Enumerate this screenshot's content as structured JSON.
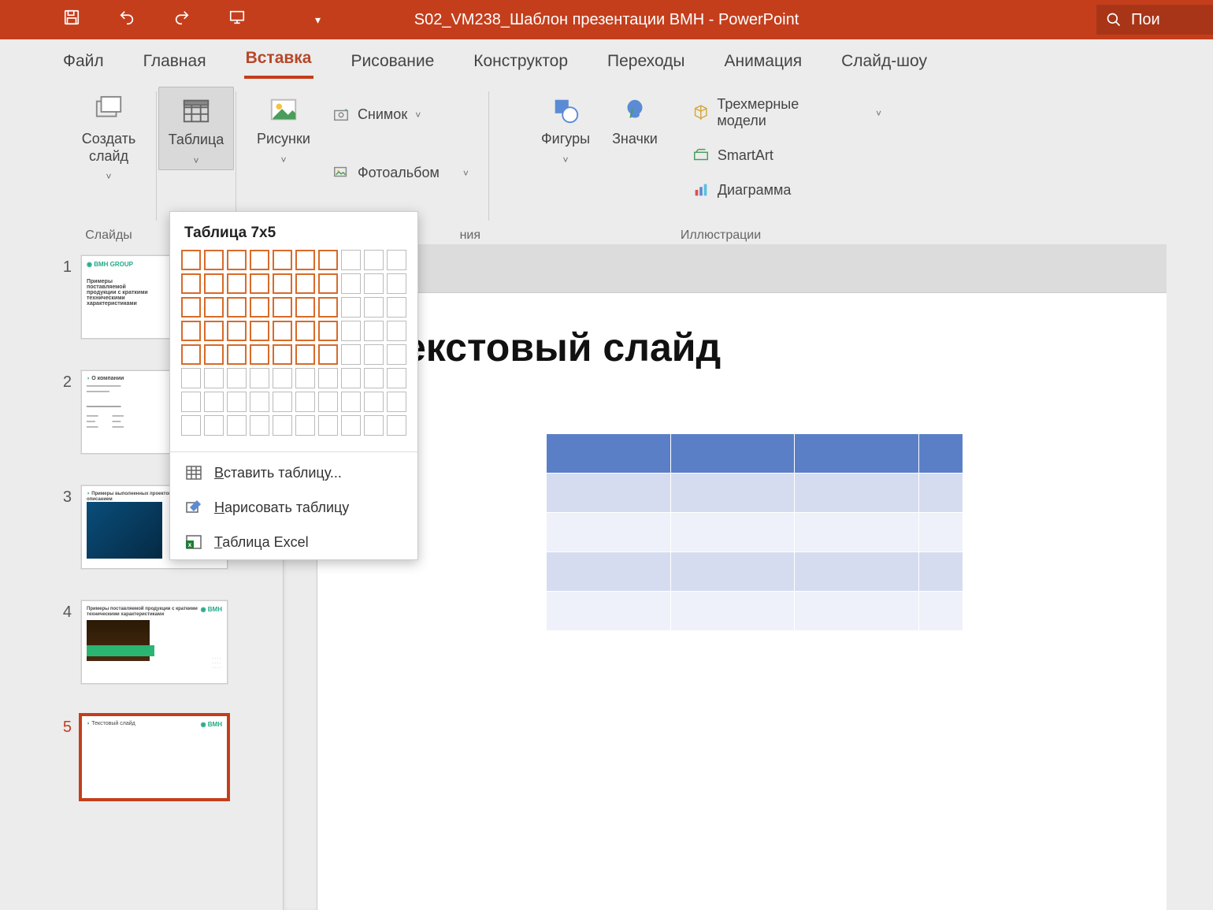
{
  "titlebar": {
    "document": "S02_VM238_Шаблон презентации BMH",
    "separator": " - ",
    "app": "PowerPoint",
    "search_label": "Пои"
  },
  "tabs": {
    "items": [
      {
        "label": "Файл"
      },
      {
        "label": "Главная"
      },
      {
        "label": "Вставка",
        "active": true
      },
      {
        "label": "Рисование"
      },
      {
        "label": "Конструктор"
      },
      {
        "label": "Переходы"
      },
      {
        "label": "Анимация"
      },
      {
        "label": "Слайд-шоу"
      }
    ]
  },
  "ribbon": {
    "new_slide": "Создать\nслайд",
    "table": "Таблица",
    "pictures": "Рисунки",
    "screenshot": "Снимок",
    "photo_album": "Фотоальбом",
    "shapes": "Фигуры",
    "icons": "Значки",
    "models3d": "Трехмерные модели",
    "smartart": "SmartArt",
    "chart": "Диаграмма",
    "group_slides": "Слайды",
    "group_images_tail": "ния",
    "group_illustrations": "Иллюстрации"
  },
  "table_dropdown": {
    "title": "Таблица 7x5",
    "cols_selected": 7,
    "rows_selected": 5,
    "grid_cols": 10,
    "grid_rows": 8,
    "insert_table": "Вставить таблицу...",
    "draw_table": "Нарисовать таблицу",
    "excel_table": "Таблица Excel",
    "insert_u": "В",
    "draw_u": "Н",
    "excel_u": "Т"
  },
  "thumbnails": [
    {
      "num": "1",
      "title": "Примеры поставляемой продукции с краткими техническими характеристиками"
    },
    {
      "num": "2",
      "title": "О компании"
    },
    {
      "num": "3",
      "title": "Примеры выполненных проектов с кратким описанием"
    },
    {
      "num": "4",
      "title": "Примеры поставляемой продукции с краткими техническими характеристиками"
    },
    {
      "num": "5",
      "title": "Текстовый слайд",
      "active": true
    }
  ],
  "slide": {
    "title": "екстовый слайд"
  }
}
